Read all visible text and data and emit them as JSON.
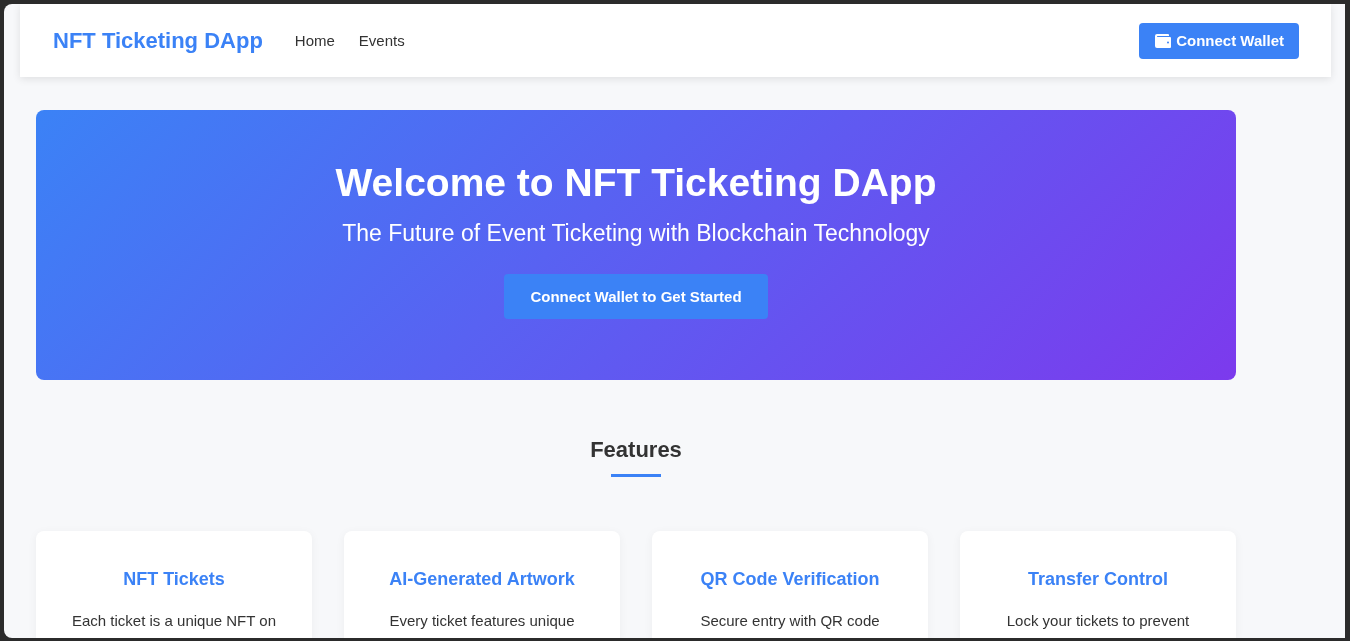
{
  "navbar": {
    "logo": "NFT Ticketing DApp",
    "links": [
      {
        "label": "Home"
      },
      {
        "label": "Events"
      }
    ],
    "connect_button": "Connect Wallet"
  },
  "hero": {
    "title": "Welcome to NFT Ticketing DApp",
    "subtitle": "The Future of Event Ticketing with Blockchain Technology",
    "button": "Connect Wallet to Get Started"
  },
  "features": {
    "heading": "Features",
    "cards": [
      {
        "title": "NFT Tickets",
        "description": "Each ticket is a unique NFT on"
      },
      {
        "title": "AI-Generated Artwork",
        "description": "Every ticket features unique"
      },
      {
        "title": "QR Code Verification",
        "description": "Secure entry with QR code"
      },
      {
        "title": "Transfer Control",
        "description": "Lock your tickets to prevent"
      }
    ]
  }
}
